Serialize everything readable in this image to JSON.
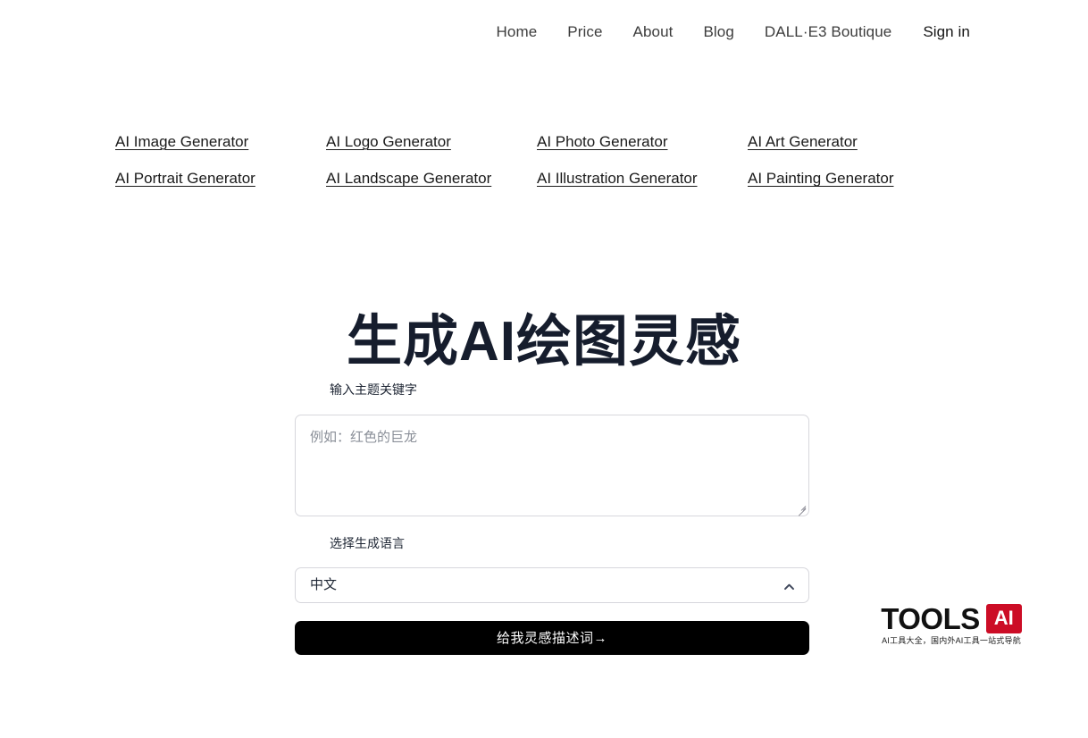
{
  "nav": {
    "items": [
      {
        "label": "Home",
        "name": "nav-item-home"
      },
      {
        "label": "Price",
        "name": "nav-item-price"
      },
      {
        "label": "About",
        "name": "nav-item-about"
      },
      {
        "label": "Blog",
        "name": "nav-item-blog"
      },
      {
        "label": "DALL·E3 Boutique",
        "name": "nav-item-dalle3-boutique"
      },
      {
        "label": "Sign in",
        "name": "nav-item-sign-in"
      }
    ]
  },
  "link_grid": {
    "links": [
      {
        "label": "AI Image Generator"
      },
      {
        "label": "AI Logo Generator"
      },
      {
        "label": "AI Photo Generator"
      },
      {
        "label": "AI Art Generator"
      },
      {
        "label": "AI Portrait Generator"
      },
      {
        "label": "AI Landscape Generator"
      },
      {
        "label": "AI Illustration Generator"
      },
      {
        "label": "AI Painting Generator"
      }
    ]
  },
  "hero": {
    "title": "生成AI绘图灵感"
  },
  "form": {
    "keyword_label": "输入主题关键字",
    "keyword_placeholder": "例如：红色的巨龙",
    "keyword_value": "",
    "language_label": "选择生成语言",
    "language_value": "中文",
    "language_chevron_icon": "chevron-up-icon",
    "submit_label": "给我灵感描述词→"
  },
  "brand": {
    "word": "TOOLS",
    "badge": "AI",
    "badge_color": "#cc0d26",
    "tagline": "AI工具大全，国内外AI工具一站式导航"
  },
  "theme": {
    "background": "#ffffff",
    "heading_color": "#161d2d",
    "button_bg": "#000000",
    "border_color": "#d7d7dc"
  }
}
